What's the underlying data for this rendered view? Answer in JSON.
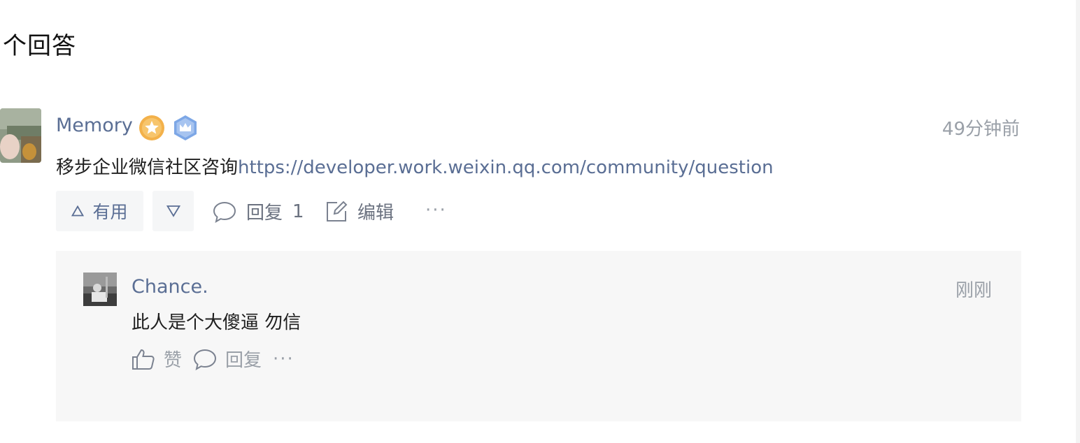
{
  "section": {
    "title": "个回答"
  },
  "answer": {
    "author": "Memory",
    "badges": [
      "star-badge-icon",
      "crown-badge-icon"
    ],
    "time": "49分钟前",
    "text": "移步企业微信社区咨询",
    "link": "https://developer.work.weixin.qq.com/community/question",
    "actions": {
      "useful_label": "有用",
      "reply_label": "回复",
      "reply_count": "1",
      "edit_label": "编辑",
      "more_label": "···"
    }
  },
  "reply": {
    "author": "Chance.",
    "time": "刚刚",
    "text": "此人是个大傻逼 勿信",
    "actions": {
      "like_label": "赞",
      "reply_label": "回复",
      "more_label": "···"
    }
  },
  "colors": {
    "link": "#5a6e94",
    "muted": "#9aa0a8",
    "box_bg": "#f7f7f7",
    "badge_gold": "#f3b14a",
    "badge_blue": "#7da7e6"
  }
}
